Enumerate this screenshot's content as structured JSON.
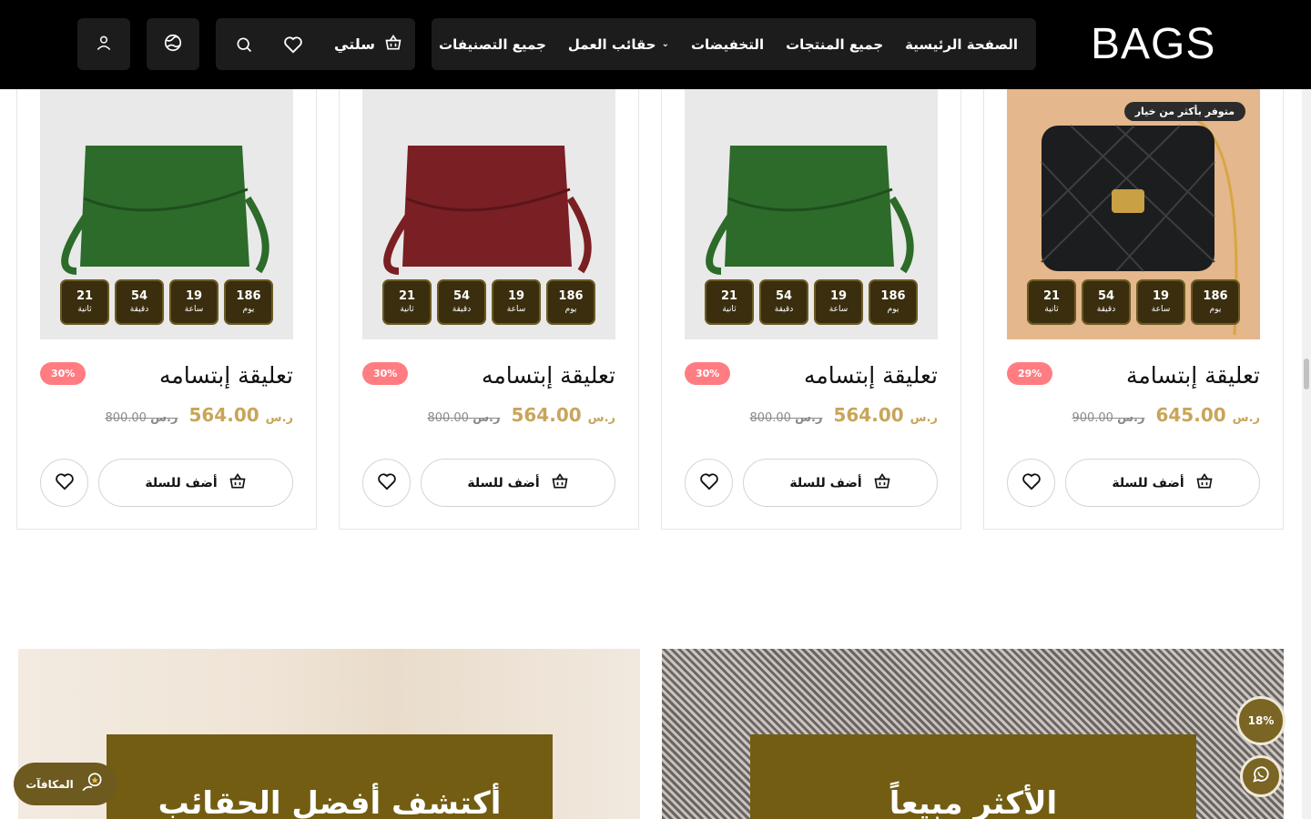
{
  "header": {
    "logo_text": "BAGS",
    "nav": [
      {
        "label": "الصفحة الرئيسية"
      },
      {
        "label": "جميع المنتجات"
      },
      {
        "label": "التخفيضات"
      },
      {
        "label": "حقائب العمل"
      },
      {
        "label": "جميع التصنيفات"
      }
    ],
    "cart_label": "سلتي",
    "icons": [
      "cart-icon",
      "heart-icon",
      "search-icon",
      "globe-icon",
      "user-icon"
    ]
  },
  "products": [
    {
      "name": "تعليقة إبتسامة",
      "badge": "متوفر بأكثر من خيار",
      "discount": "29%",
      "price": "645.00",
      "old_price": "900.00",
      "bag_color": "#1c1d1f",
      "timer": [
        {
          "n": "186",
          "l": "يوم"
        },
        {
          "n": "19",
          "l": "ساعة"
        },
        {
          "n": "54",
          "l": "دقيقة"
        },
        {
          "n": "21",
          "l": "ثانية"
        }
      ],
      "add_label": "أضف للسلة"
    },
    {
      "name": "تعليقة إبتسامه",
      "badge": "",
      "discount": "30%",
      "price": "564.00",
      "old_price": "800.00",
      "bag_color": "#2c6b2a",
      "timer": [
        {
          "n": "186",
          "l": "يوم"
        },
        {
          "n": "19",
          "l": "ساعة"
        },
        {
          "n": "54",
          "l": "دقيقة"
        },
        {
          "n": "21",
          "l": "ثانية"
        }
      ],
      "add_label": "أضف للسلة"
    },
    {
      "name": "تعليقة إبتسامه",
      "badge": "",
      "discount": "30%",
      "price": "564.00",
      "old_price": "800.00",
      "bag_color": "#7a1f23",
      "timer": [
        {
          "n": "186",
          "l": "يوم"
        },
        {
          "n": "19",
          "l": "ساعة"
        },
        {
          "n": "54",
          "l": "دقيقة"
        },
        {
          "n": "21",
          "l": "ثانية"
        }
      ],
      "add_label": "أضف للسلة"
    },
    {
      "name": "تعليقة إبتسامه",
      "badge": "",
      "discount": "30%",
      "price": "564.00",
      "old_price": "800.00",
      "bag_color": "#2c6b2a",
      "timer": [
        {
          "n": "186",
          "l": "يوم"
        },
        {
          "n": "19",
          "l": "ساعة"
        },
        {
          "n": "54",
          "l": "دقيقة"
        },
        {
          "n": "21",
          "l": "ثانية"
        }
      ],
      "add_label": "أضف للسلة"
    }
  ],
  "currency_symbol": "ر.س",
  "banners": [
    {
      "title": "الأكثر مبيعاً"
    },
    {
      "title": "أكتشف أفضل الحقائب"
    }
  ],
  "floating": {
    "rewards_label": "المكافآت",
    "progress_label": "18%"
  },
  "colors": {
    "accent": "#c8a55a",
    "brand_olive": "#735d12",
    "discount": "#ff7d82",
    "header_bg": "#000000"
  }
}
